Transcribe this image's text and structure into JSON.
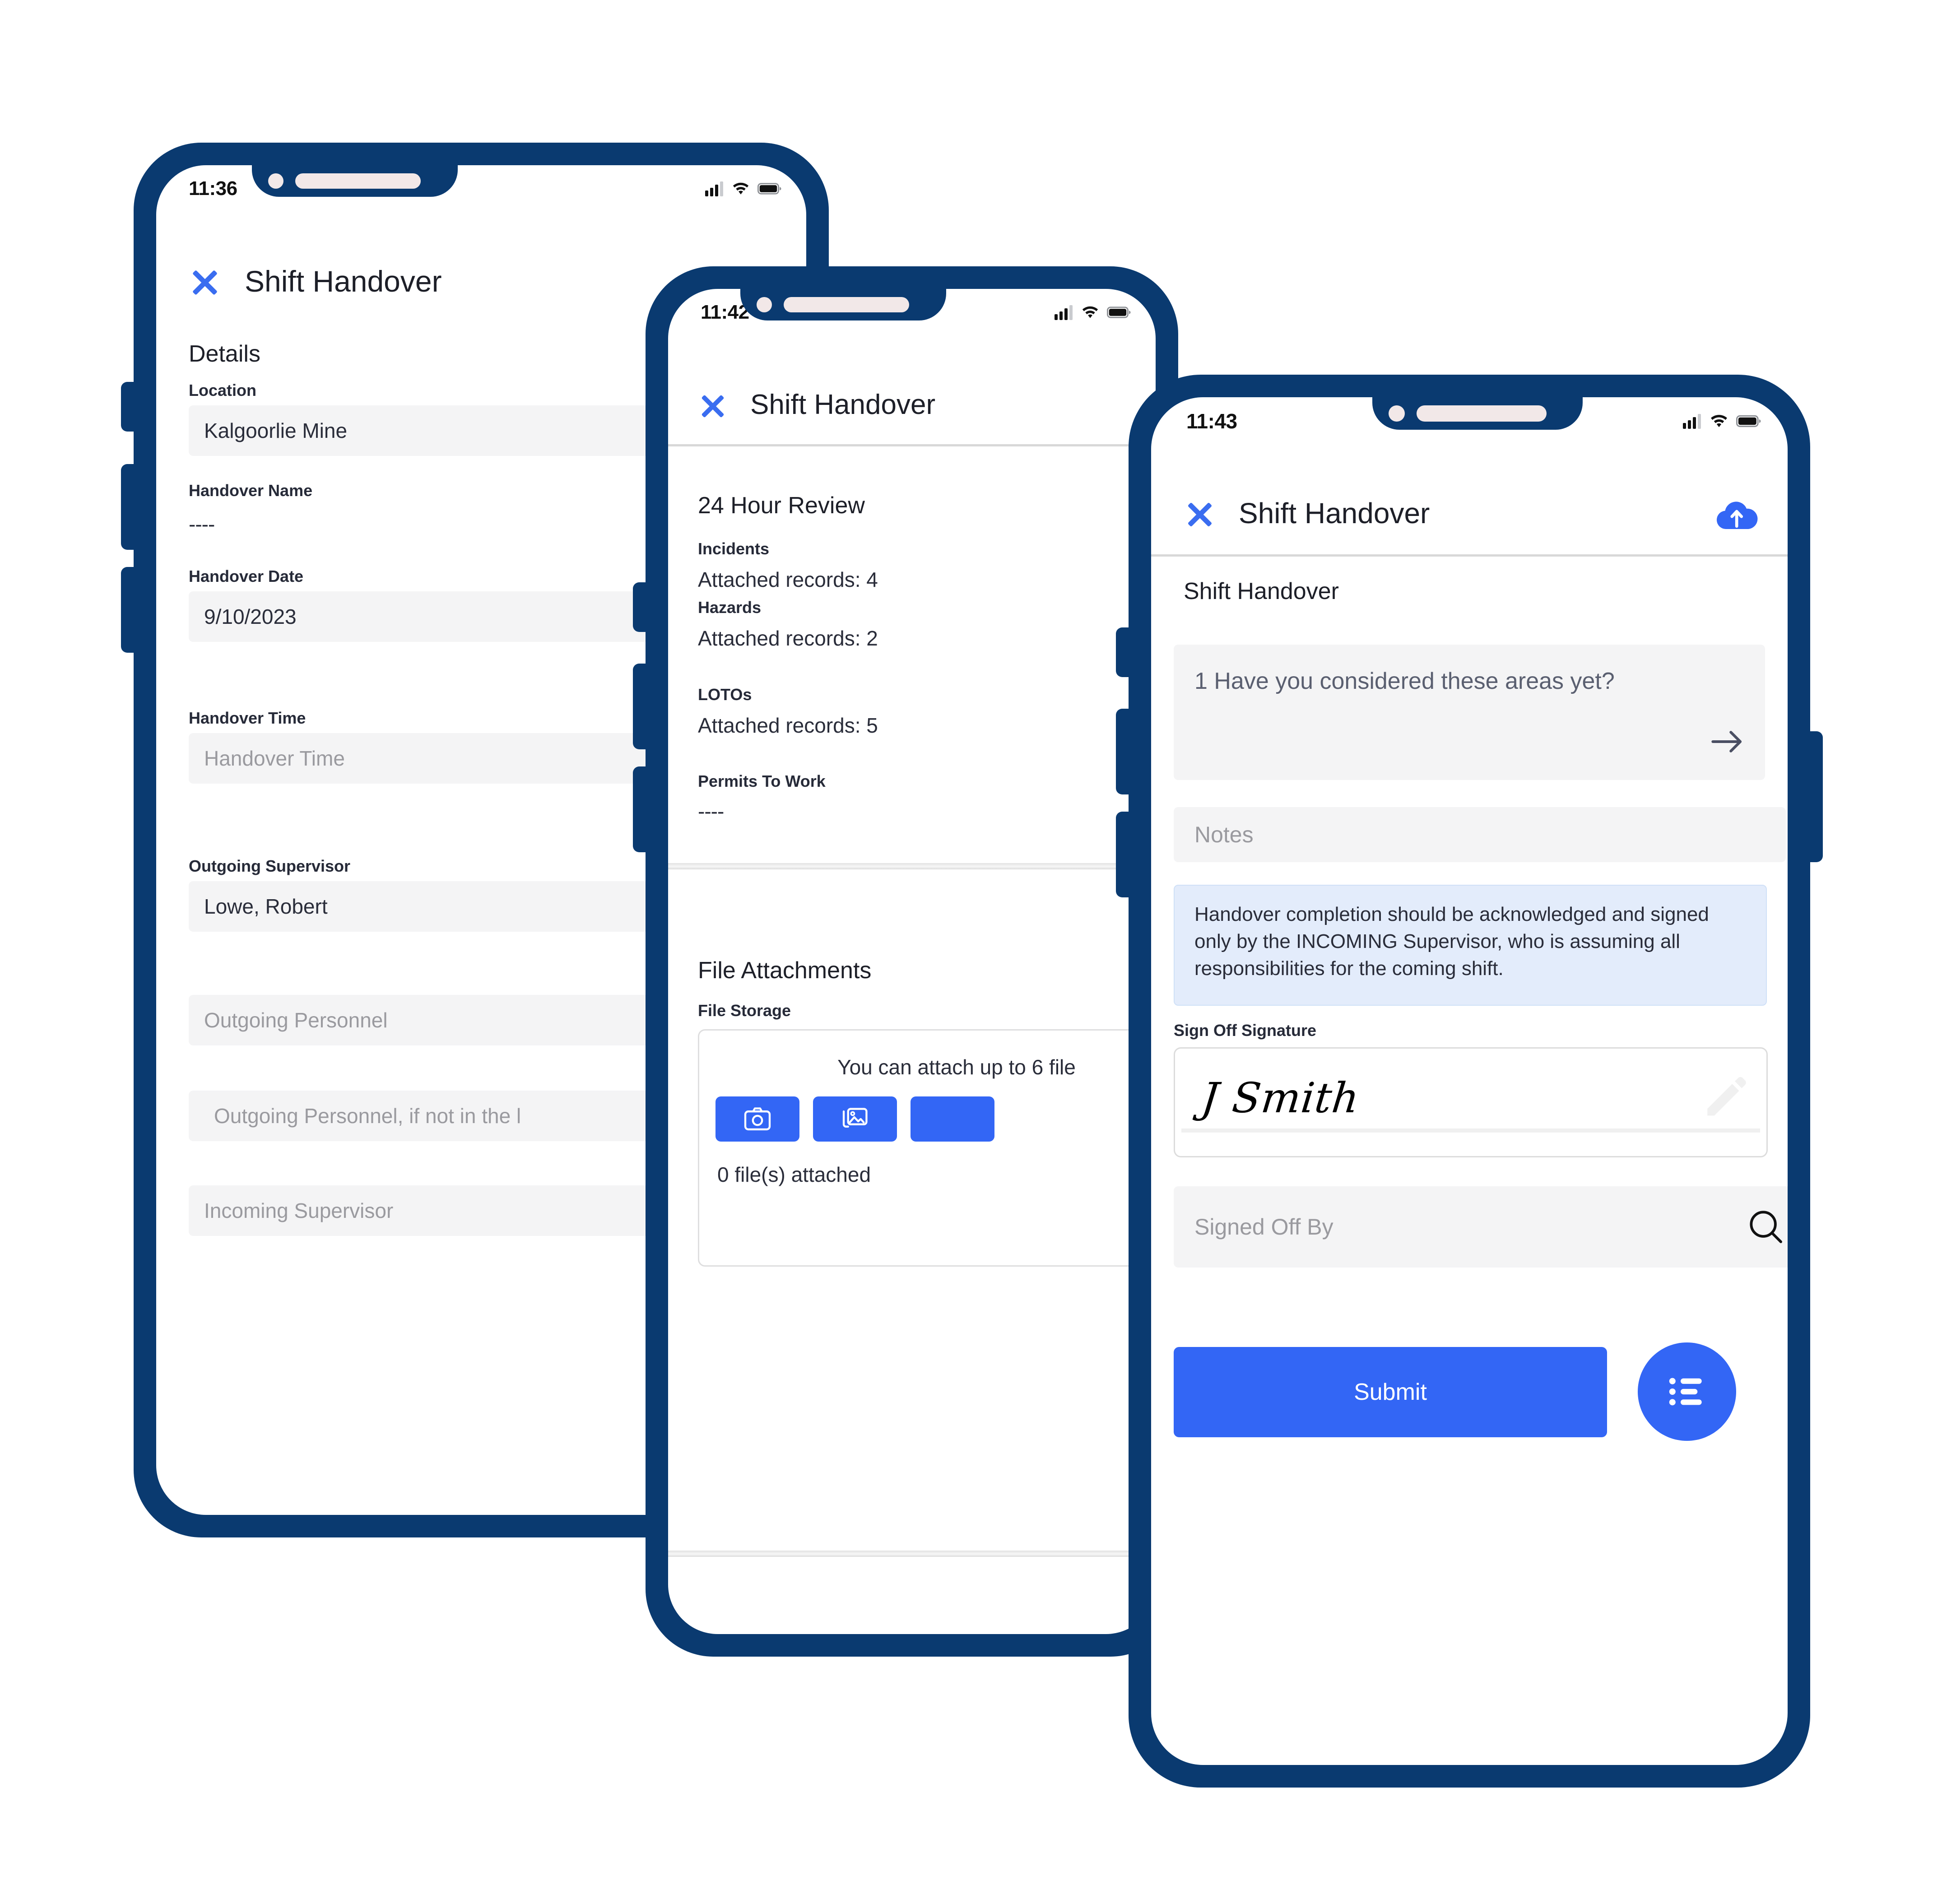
{
  "brand": {
    "bezel_color": "#0a3a70",
    "accent_blue": "#3366f5",
    "link_blue": "#3a6df0",
    "field_bg": "#f4f4f5",
    "info_bg": "#e3ecfb"
  },
  "phones": [
    {
      "id": "phone-details",
      "status": {
        "time": "11:36",
        "signal_icon": "signal-bars-icon",
        "wifi_icon": "wifi-icon",
        "battery_icon": "battery-icon"
      },
      "header": {
        "close_icon": "close-x-icon",
        "title": "Shift Handover"
      },
      "section_title": "Details",
      "fields": [
        {
          "type": "filled",
          "label": "Location",
          "value": "Kalgoorlie Mine"
        },
        {
          "type": "plain",
          "label": "Handover Name",
          "value": "----"
        },
        {
          "type": "filled",
          "label": "Handover Date",
          "value": "9/10/2023"
        },
        {
          "type": "placeholder",
          "label": "Handover Time",
          "value": "Handover Time"
        },
        {
          "type": "filled",
          "label": "Outgoing Supervisor",
          "value": "Lowe, Robert"
        },
        {
          "type": "placeholder",
          "label": "",
          "value": "Outgoing Personnel"
        },
        {
          "type": "placeholder",
          "label": "",
          "value": "Outgoing Personnel, if not in the l"
        },
        {
          "type": "placeholder",
          "label": "",
          "value": "Incoming Supervisor"
        }
      ]
    },
    {
      "id": "phone-review",
      "status": {
        "time": "11:42",
        "signal_icon": "signal-bars-icon",
        "wifi_icon": "wifi-icon",
        "battery_icon": "battery-icon"
      },
      "header": {
        "close_icon": "close-x-icon",
        "title": "Shift Handover"
      },
      "review": {
        "title": "24 Hour Review",
        "items": [
          {
            "label": "Incidents",
            "value": "Attached records: 4"
          },
          {
            "label": "Hazards",
            "value": "Attached records: 2"
          },
          {
            "label": "LOTOs",
            "value": "Attached records: 5"
          },
          {
            "label": "Permits To Work",
            "value": "----"
          }
        ]
      },
      "attachments": {
        "title": "File Attachments",
        "label": "File Storage",
        "note": "You can attach up to 6 file",
        "buttons": [
          {
            "icon": "camera-icon"
          },
          {
            "icon": "gallery-icon"
          },
          {
            "icon": "attachment-icon"
          }
        ],
        "count": "0 file(s) attached"
      }
    },
    {
      "id": "phone-signoff",
      "status": {
        "time": "11:43",
        "signal_icon": "signal-bars-icon",
        "wifi_icon": "wifi-icon",
        "battery_icon": "battery-icon"
      },
      "header": {
        "close_icon": "close-x-icon",
        "title": "Shift Handover",
        "upload_icon": "cloud-upload-icon"
      },
      "breadcrumb": "Shift Handover",
      "question": {
        "text": "1 Have you considered these areas yet?",
        "arrow_icon": "arrow-right-icon"
      },
      "notes_placeholder": "Notes",
      "info_text": "Handover completion should be acknowledged and signed only by the INCOMING Supervisor, who is assuming all responsibilities for the coming shift.",
      "signature": {
        "label": "Sign Off Signature",
        "value": "J Smith",
        "edit_icon": "pencil-icon"
      },
      "signed_off_by": {
        "placeholder": "Signed Off By",
        "search_icon": "search-icon"
      },
      "submit_label": "Submit",
      "fab_icon": "list-icon"
    }
  ]
}
